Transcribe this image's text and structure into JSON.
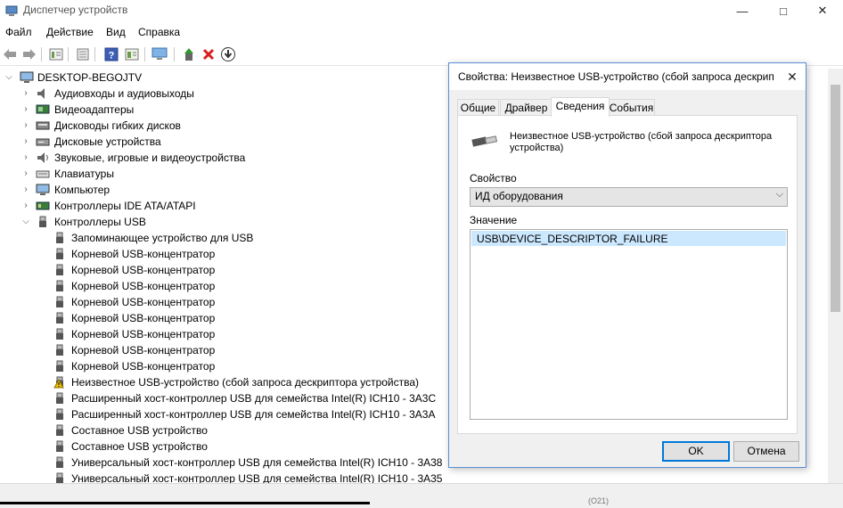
{
  "window": {
    "title": "Диспетчер устройств",
    "controls": [
      "minimize-icon",
      "maximize-icon",
      "close-icon"
    ]
  },
  "menu": [
    "Файл",
    "Действие",
    "Вид",
    "Справка"
  ],
  "toolbar": [
    "back-icon",
    "forward-icon",
    "properties-icon",
    "update-icon",
    "help-icon",
    "view-icon",
    "monitor-icon",
    "enable-device-icon",
    "uninstall-icon",
    "download-icon"
  ],
  "tree": {
    "root": "DESKTOP-BEGOJTV",
    "categories": [
      {
        "label": "Аудиовходы и аудиовыходы",
        "icon": "audio-icon",
        "expanded": false
      },
      {
        "label": "Видеоадаптеры",
        "icon": "display-adapter-icon",
        "expanded": false
      },
      {
        "label": "Дисководы гибких дисков",
        "icon": "floppy-icon",
        "expanded": false
      },
      {
        "label": "Дисковые устройства",
        "icon": "disk-icon",
        "expanded": false
      },
      {
        "label": "Звуковые, игровые и видеоустройства",
        "icon": "sound-icon",
        "expanded": false
      },
      {
        "label": "Клавиатуры",
        "icon": "keyboard-icon",
        "expanded": false
      },
      {
        "label": "Компьютер",
        "icon": "computer-icon",
        "expanded": false
      },
      {
        "label": "Контроллеры IDE ATA/ATAPI",
        "icon": "ide-icon",
        "expanded": false
      },
      {
        "label": "Контроллеры USB",
        "icon": "usb-icon",
        "expanded": true
      }
    ],
    "usb_devices": [
      {
        "label": "Запоминающее устройство для USB",
        "warning": false
      },
      {
        "label": "Корневой USB-концентратор",
        "warning": false
      },
      {
        "label": "Корневой USB-концентратор",
        "warning": false
      },
      {
        "label": "Корневой USB-концентратор",
        "warning": false
      },
      {
        "label": "Корневой USB-концентратор",
        "warning": false
      },
      {
        "label": "Корневой USB-концентратор",
        "warning": false
      },
      {
        "label": "Корневой USB-концентратор",
        "warning": false
      },
      {
        "label": "Корневой USB-концентратор",
        "warning": false
      },
      {
        "label": "Корневой USB-концентратор",
        "warning": false
      },
      {
        "label": "Неизвестное USB-устройство (сбой запроса дескриптора устройства)",
        "warning": true
      },
      {
        "label": "Расширенный хост-контроллер USB для семейства Intel(R) ICH10 - 3A3C",
        "warning": false
      },
      {
        "label": "Расширенный хост-контроллер USB для семейства Intel(R) ICH10 - 3A3A",
        "warning": false
      },
      {
        "label": "Составное USB устройство",
        "warning": false
      },
      {
        "label": "Составное USB устройство",
        "warning": false
      },
      {
        "label": "Универсальный хост-контроллер USB для семейства Intel(R) ICH10 - 3A38",
        "warning": false
      },
      {
        "label": "Универсальный хост-контроллер USB для семейства Intel(R) ICH10 - 3A35",
        "warning": false
      }
    ]
  },
  "status": {
    "text": "(O21)"
  },
  "dialog": {
    "title": "Свойства: Неизвестное USB-устройство (сбой запроса дескрип",
    "tabs": [
      {
        "label": "Общие",
        "active": false
      },
      {
        "label": "Драйвер",
        "active": false
      },
      {
        "label": "Сведения",
        "active": true
      },
      {
        "label": "События",
        "active": false
      }
    ],
    "device_name": "Неизвестное USB-устройство (сбой запроса дескриптора устройства)",
    "property_label": "Свойство",
    "property_value": "ИД оборудования",
    "value_label": "Значение",
    "values": [
      "USB\\DEVICE_DESCRIPTOR_FAILURE"
    ],
    "ok": "OK",
    "cancel": "Отмена"
  }
}
